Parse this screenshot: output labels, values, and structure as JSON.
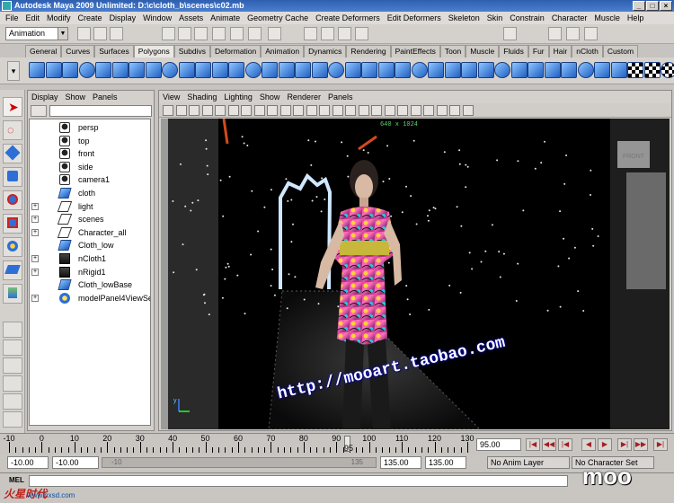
{
  "window": {
    "title": "Autodesk Maya 2009 Unlimited: D:\\c\\cloth_b\\scenes\\c02.mb",
    "controls": [
      "_",
      "□",
      "×"
    ]
  },
  "menubar": [
    "File",
    "Edit",
    "Modify",
    "Create",
    "Display",
    "Window",
    "Assets",
    "Animate",
    "Geometry Cache",
    "Create Deformers",
    "Edit Deformers",
    "Skeleton",
    "Skin",
    "Constrain",
    "Character",
    "Muscle",
    "Help"
  ],
  "statusline": {
    "mode": "Animation"
  },
  "shelf": {
    "tabs": [
      "General",
      "Curves",
      "Surfaces",
      "Polygons",
      "Subdivs",
      "Deformation",
      "Animation",
      "Dynamics",
      "Rendering",
      "PaintEffects",
      "Toon",
      "Muscle",
      "Fluids",
      "Fur",
      "Hair",
      "nCloth",
      "Custom"
    ],
    "active_tab": "Polygons"
  },
  "outliner": {
    "menu": [
      "Display",
      "Show",
      "Panels"
    ],
    "items": [
      {
        "label": "persp",
        "icon": "camera-icon",
        "expandable": false
      },
      {
        "label": "top",
        "icon": "camera-icon",
        "expandable": false
      },
      {
        "label": "front",
        "icon": "camera-icon",
        "expandable": false
      },
      {
        "label": "side",
        "icon": "camera-icon",
        "expandable": false
      },
      {
        "label": "camera1",
        "icon": "camera-icon",
        "expandable": false
      },
      {
        "label": "cloth",
        "icon": "mesh-icon",
        "expandable": false
      },
      {
        "label": "light",
        "icon": "group-icon",
        "expandable": true
      },
      {
        "label": "scenes",
        "icon": "group-icon",
        "expandable": true
      },
      {
        "label": "Character_all",
        "icon": "group-icon",
        "expandable": true
      },
      {
        "label": "Cloth_low",
        "icon": "mesh-icon",
        "expandable": false
      },
      {
        "label": "nCloth1",
        "icon": "ncloth-icon",
        "expandable": true
      },
      {
        "label": "nRigid1",
        "icon": "ncloth-icon",
        "expandable": true
      },
      {
        "label": "Cloth_lowBase",
        "icon": "mesh-icon",
        "expandable": false
      },
      {
        "label": "modelPanel4ViewSele",
        "icon": "panel-icon",
        "expandable": true
      }
    ]
  },
  "viewport": {
    "menu": [
      "View",
      "Shading",
      "Lighting",
      "Show",
      "Renderer",
      "Panels"
    ],
    "resolution_gate": "640 x 1024",
    "view_cube_label": "FRONT"
  },
  "timeslider": {
    "ticks": [
      -10,
      0,
      10,
      20,
      30,
      40,
      50,
      60,
      70,
      80,
      90,
      100,
      110,
      120,
      130
    ],
    "current_marker": "95",
    "current_time": "95.00"
  },
  "rangeslider": {
    "start_time": "-10.00",
    "playback_start": "-10.00",
    "range_start_label": "-10",
    "range_end_label": "135",
    "playback_end": "135.00",
    "end_time": "135.00",
    "anim_layer": "No Anim Layer",
    "character_set": "No Character Set"
  },
  "cmdline": {
    "label": "MEL"
  },
  "watermarks": {
    "top": "http://mooart.taobao.com",
    "bottom": "http://mooart.taobao.com",
    "logo_left": "火星时代",
    "logo_left_url": "www.hxsd.com",
    "logo_right": "moo"
  },
  "colors": {
    "titlebar": "#2f5fb0",
    "shelf_icon": "#1f5fc2",
    "viewport_bg": "#000000",
    "outline_highlight": "#ffffff"
  }
}
